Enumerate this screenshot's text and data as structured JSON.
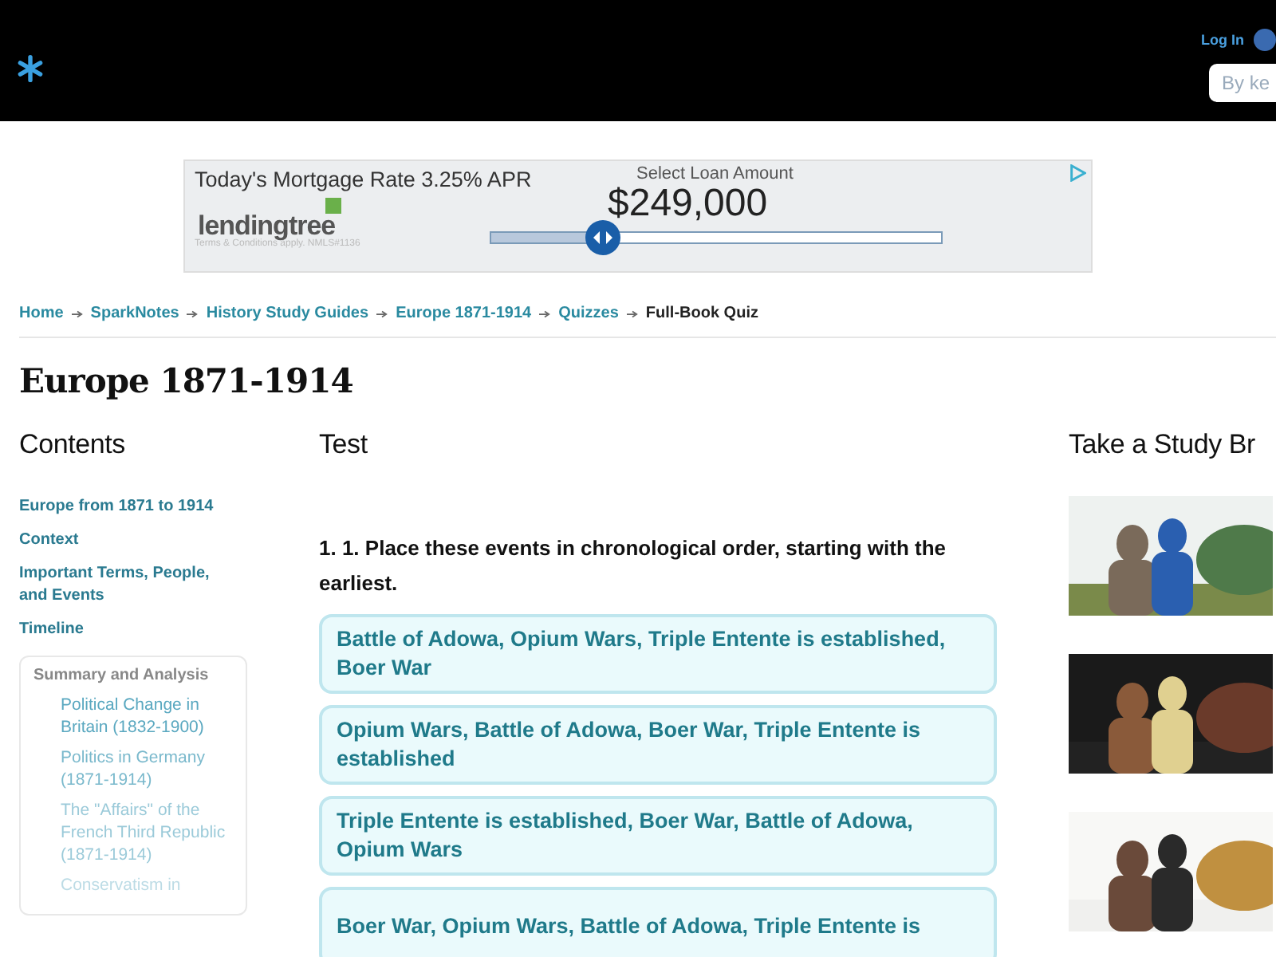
{
  "header": {
    "login": "Log In",
    "search": {
      "placeholder": "By ke"
    }
  },
  "ad": {
    "headline": "Today's Mortgage Rate 3.25% APR",
    "brand": "lendingtree",
    "terms": "Terms & Conditions apply. NMLS#1136",
    "slider_label": "Select Loan Amount",
    "amount": "$249,000",
    "slider": {
      "level": 0.25
    }
  },
  "breadcrumbs": [
    {
      "label": "Home",
      "current": false
    },
    {
      "label": "SparkNotes",
      "current": false
    },
    {
      "label": "History Study Guides",
      "current": false
    },
    {
      "label": "Europe 1871-1914",
      "current": false
    },
    {
      "label": "Quizzes",
      "current": false
    },
    {
      "label": "Full-Book Quiz",
      "current": true
    }
  ],
  "title": "Europe 1871-1914",
  "sidebar": {
    "heading": "Contents",
    "links": [
      "Europe from 1871 to 1914",
      "Context",
      "Important Terms, People, and Events",
      "Timeline"
    ],
    "section": {
      "heading": "Summary and Analysis",
      "items": [
        "Political Change in Britain (1832-1900)",
        "Politics in Germany (1871-1914)",
        "The \"Affairs\" of the French Third Republic (1871-1914)",
        "Conservatism in"
      ]
    }
  },
  "quiz": {
    "heading": "Test",
    "question": "1. 1. Place these events in chronological order, starting with the earliest.",
    "answers": [
      "Battle of Adowa, Opium Wars, Triple Entente is established, Boer War",
      "Opium Wars, Battle of Adowa, Boer War, Triple Entente is established",
      "Triple Entente is established, Boer War, Battle of Adowa, Opium Wars",
      "Boer War, Opium Wars, Battle of Adowa, Triple Entente is"
    ]
  },
  "study_break": {
    "heading": "Take a Study Br"
  }
}
